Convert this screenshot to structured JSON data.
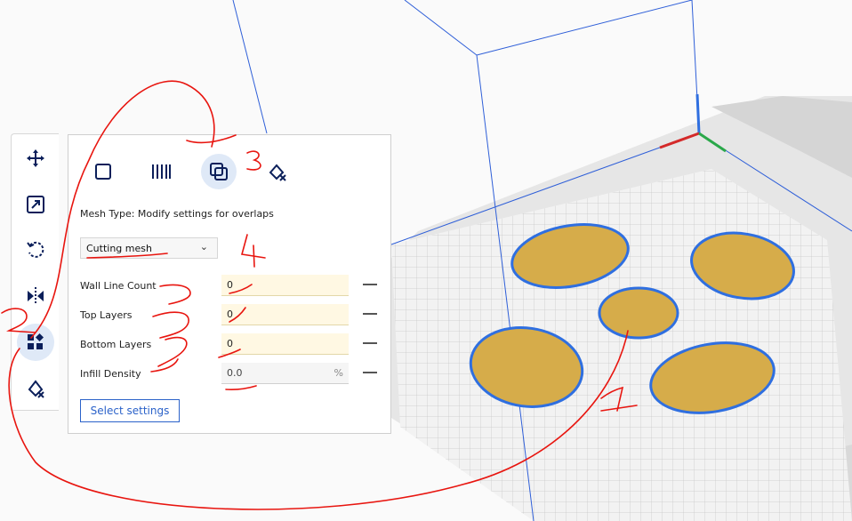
{
  "panel": {
    "mesh_type_label": "Mesh Type: Modify settings for overlaps",
    "mesh_type_value": "Cutting mesh",
    "select_settings_label": "Select settings",
    "mesh_type_buttons": [
      "normal-model-icon",
      "support-mesh-icon",
      "overlap-mesh-icon",
      "anti-overhang-mesh-icon"
    ],
    "rows": [
      {
        "label": "Wall Line Count",
        "value": "0",
        "unit": ""
      },
      {
        "label": "Top Layers",
        "value": "0",
        "unit": ""
      },
      {
        "label": "Bottom Layers",
        "value": "0",
        "unit": ""
      },
      {
        "label": "Infill Density",
        "value": "0.0",
        "unit": "%"
      }
    ]
  },
  "toolbar": {
    "tools": [
      "move-icon",
      "scale-icon",
      "rotate-icon",
      "mirror-icon",
      "per-model-settings-icon",
      "support-blocker-icon"
    ]
  },
  "annotations": [
    "1",
    "2",
    "3",
    "4"
  ],
  "colors": {
    "accent": "#2b62c9",
    "model_fill": "#d6ac4a",
    "model_outline": "#2f6fe0",
    "input_bg": "#fff8e3"
  }
}
